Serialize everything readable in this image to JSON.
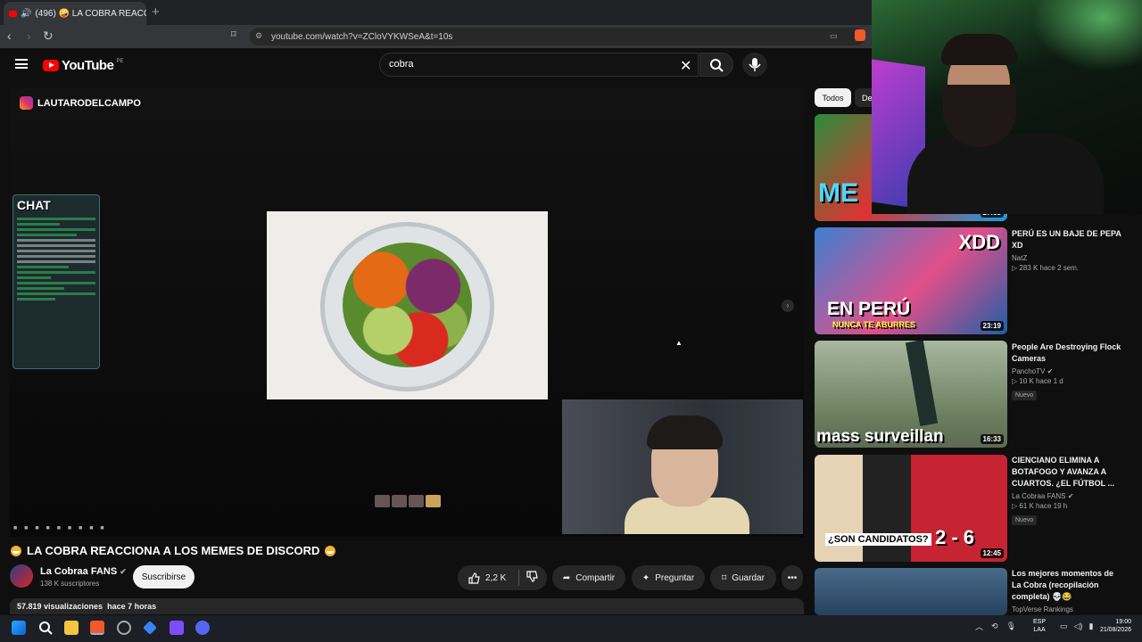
{
  "browser": {
    "tab_title": "(496) 🤪 LA COBRA REACCIO...",
    "url": "youtube.com/watch?v=ZCloVYKWSeA&t=10s"
  },
  "youtube": {
    "logo_text": "YouTube",
    "country_code": "PE",
    "search_value": "cobra"
  },
  "player": {
    "overlay_account": "LAUTARODELCAMPO",
    "chat_title": "CHAT"
  },
  "video": {
    "title": "LA COBRA REACCIONA A LOS MEMES DE DISCORD",
    "channel": "La Cobraa FANS",
    "verified_icon": "check-circle-icon",
    "subscribers": "138 K suscriptores",
    "subscribe_label": "Suscribirse",
    "likes": "2,2 K",
    "share_label": "Compartir",
    "ask_label": "Preguntar",
    "save_label": "Guardar",
    "views": "57.819 visualizaciones",
    "age": "hace 7 horas"
  },
  "sidebar": {
    "chips": [
      "Todos",
      "De"
    ],
    "items": [
      {
        "title": "",
        "channel": "",
        "meta": "",
        "duration": "27:58",
        "thumb_text": "ME"
      },
      {
        "title": "PERÚ ES UN BAJE DE PEPA XD",
        "channel": "NatZ",
        "meta": "▷ 283 K  hace 2 sem.",
        "duration": "23:19",
        "thumb_text": "EN PERÚ",
        "thumb_text2": "XDD",
        "thumb_text3": "NUNCA TE ABURRES",
        "badge": ""
      },
      {
        "title": "People Are Destroying Flock Cameras",
        "channel": "PanchoTV",
        "meta": "▷ 10 K  hace 1 d",
        "duration": "16:33",
        "thumb_text": "mass surveillan",
        "badge": "Nuevo"
      },
      {
        "title": "CIENCIANO ELIMINA A BOTAFOGO Y AVANZA A CUARTOS. ¿EL FÚTBOL ...",
        "channel": "La Cobraa FANS",
        "meta": "▷ 61 K  hace 19 h",
        "duration": "12:45",
        "thumb_text": "¿SON CANDIDATOS?",
        "thumb_text2": "2 - 6",
        "badge": "Nuevo"
      },
      {
        "title": "Los mejores momentos de La Cobra (recopilación completa) 💀😂",
        "channel": "TopVerse Rankings",
        "meta": "",
        "duration": "",
        "thumb_text": ""
      }
    ]
  },
  "taskbar": {
    "lang": "ESP",
    "lang2": "LAA",
    "time": "19:00",
    "date": "21/08/2026"
  }
}
